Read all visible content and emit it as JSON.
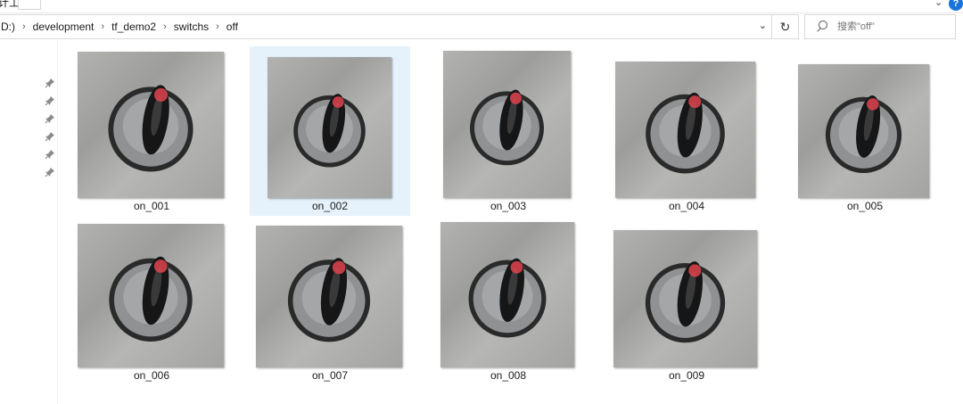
{
  "ribbon": {
    "tools_label": "计工具",
    "help_icon": "question-icon"
  },
  "address": {
    "crumbs": [
      "D:)",
      "development",
      "tf_demo2",
      "switchs",
      "off"
    ],
    "dropdown_icon": "chevron-down-icon",
    "refresh_icon": "refresh-icon"
  },
  "search": {
    "placeholder": "搜索\"off\"",
    "icon": "search-icon"
  },
  "files": [
    {
      "name": "on_001"
    },
    {
      "name": "on_002",
      "selected": true
    },
    {
      "name": "on_003"
    },
    {
      "name": "on_004"
    },
    {
      "name": "on_005"
    },
    {
      "name": "on_006"
    },
    {
      "name": "on_007"
    },
    {
      "name": "on_008"
    },
    {
      "name": "on_009"
    }
  ],
  "colors": {
    "selection": "#e5f1fb",
    "marker": "#d9434c",
    "accent": "#1a73d9"
  }
}
